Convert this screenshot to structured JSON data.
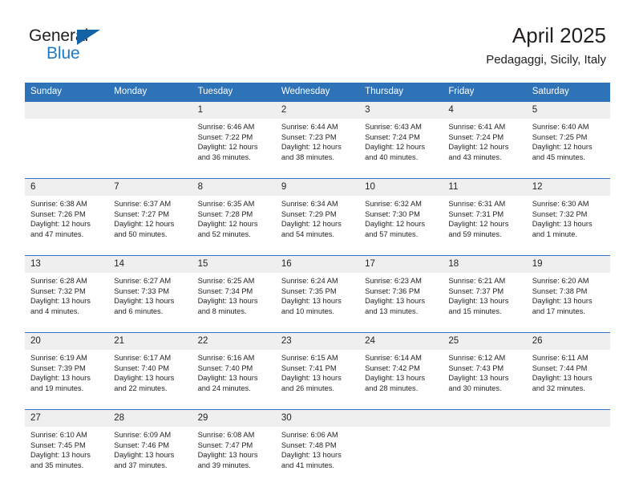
{
  "brand": {
    "name_top": "General",
    "name_bottom": "Blue",
    "triangle_color": "#1464a5",
    "blue_color": "#1f7ac4"
  },
  "header": {
    "title": "April 2025",
    "subtitle": "Pedagaggi, Sicily, Italy"
  },
  "theme": {
    "header_blue": "#2e72b8",
    "daynum_gray": "#efefef",
    "text": "#231f20"
  },
  "calendar": {
    "weekday_headers": [
      "Sunday",
      "Monday",
      "Tuesday",
      "Wednesday",
      "Thursday",
      "Friday",
      "Saturday"
    ],
    "weeks": [
      [
        {
          "day": "",
          "lines": []
        },
        {
          "day": "",
          "lines": []
        },
        {
          "day": "1",
          "lines": [
            "Sunrise: 6:46 AM",
            "Sunset: 7:22 PM",
            "Daylight: 12 hours",
            "and 36 minutes."
          ]
        },
        {
          "day": "2",
          "lines": [
            "Sunrise: 6:44 AM",
            "Sunset: 7:23 PM",
            "Daylight: 12 hours",
            "and 38 minutes."
          ]
        },
        {
          "day": "3",
          "lines": [
            "Sunrise: 6:43 AM",
            "Sunset: 7:24 PM",
            "Daylight: 12 hours",
            "and 40 minutes."
          ]
        },
        {
          "day": "4",
          "lines": [
            "Sunrise: 6:41 AM",
            "Sunset: 7:24 PM",
            "Daylight: 12 hours",
            "and 43 minutes."
          ]
        },
        {
          "day": "5",
          "lines": [
            "Sunrise: 6:40 AM",
            "Sunset: 7:25 PM",
            "Daylight: 12 hours",
            "and 45 minutes."
          ]
        }
      ],
      [
        {
          "day": "6",
          "lines": [
            "Sunrise: 6:38 AM",
            "Sunset: 7:26 PM",
            "Daylight: 12 hours",
            "and 47 minutes."
          ]
        },
        {
          "day": "7",
          "lines": [
            "Sunrise: 6:37 AM",
            "Sunset: 7:27 PM",
            "Daylight: 12 hours",
            "and 50 minutes."
          ]
        },
        {
          "day": "8",
          "lines": [
            "Sunrise: 6:35 AM",
            "Sunset: 7:28 PM",
            "Daylight: 12 hours",
            "and 52 minutes."
          ]
        },
        {
          "day": "9",
          "lines": [
            "Sunrise: 6:34 AM",
            "Sunset: 7:29 PM",
            "Daylight: 12 hours",
            "and 54 minutes."
          ]
        },
        {
          "day": "10",
          "lines": [
            "Sunrise: 6:32 AM",
            "Sunset: 7:30 PM",
            "Daylight: 12 hours",
            "and 57 minutes."
          ]
        },
        {
          "day": "11",
          "lines": [
            "Sunrise: 6:31 AM",
            "Sunset: 7:31 PM",
            "Daylight: 12 hours",
            "and 59 minutes."
          ]
        },
        {
          "day": "12",
          "lines": [
            "Sunrise: 6:30 AM",
            "Sunset: 7:32 PM",
            "Daylight: 13 hours",
            "and 1 minute."
          ]
        }
      ],
      [
        {
          "day": "13",
          "lines": [
            "Sunrise: 6:28 AM",
            "Sunset: 7:32 PM",
            "Daylight: 13 hours",
            "and 4 minutes."
          ]
        },
        {
          "day": "14",
          "lines": [
            "Sunrise: 6:27 AM",
            "Sunset: 7:33 PM",
            "Daylight: 13 hours",
            "and 6 minutes."
          ]
        },
        {
          "day": "15",
          "lines": [
            "Sunrise: 6:25 AM",
            "Sunset: 7:34 PM",
            "Daylight: 13 hours",
            "and 8 minutes."
          ]
        },
        {
          "day": "16",
          "lines": [
            "Sunrise: 6:24 AM",
            "Sunset: 7:35 PM",
            "Daylight: 13 hours",
            "and 10 minutes."
          ]
        },
        {
          "day": "17",
          "lines": [
            "Sunrise: 6:23 AM",
            "Sunset: 7:36 PM",
            "Daylight: 13 hours",
            "and 13 minutes."
          ]
        },
        {
          "day": "18",
          "lines": [
            "Sunrise: 6:21 AM",
            "Sunset: 7:37 PM",
            "Daylight: 13 hours",
            "and 15 minutes."
          ]
        },
        {
          "day": "19",
          "lines": [
            "Sunrise: 6:20 AM",
            "Sunset: 7:38 PM",
            "Daylight: 13 hours",
            "and 17 minutes."
          ]
        }
      ],
      [
        {
          "day": "20",
          "lines": [
            "Sunrise: 6:19 AM",
            "Sunset: 7:39 PM",
            "Daylight: 13 hours",
            "and 19 minutes."
          ]
        },
        {
          "day": "21",
          "lines": [
            "Sunrise: 6:17 AM",
            "Sunset: 7:40 PM",
            "Daylight: 13 hours",
            "and 22 minutes."
          ]
        },
        {
          "day": "22",
          "lines": [
            "Sunrise: 6:16 AM",
            "Sunset: 7:40 PM",
            "Daylight: 13 hours",
            "and 24 minutes."
          ]
        },
        {
          "day": "23",
          "lines": [
            "Sunrise: 6:15 AM",
            "Sunset: 7:41 PM",
            "Daylight: 13 hours",
            "and 26 minutes."
          ]
        },
        {
          "day": "24",
          "lines": [
            "Sunrise: 6:14 AM",
            "Sunset: 7:42 PM",
            "Daylight: 13 hours",
            "and 28 minutes."
          ]
        },
        {
          "day": "25",
          "lines": [
            "Sunrise: 6:12 AM",
            "Sunset: 7:43 PM",
            "Daylight: 13 hours",
            "and 30 minutes."
          ]
        },
        {
          "day": "26",
          "lines": [
            "Sunrise: 6:11 AM",
            "Sunset: 7:44 PM",
            "Daylight: 13 hours",
            "and 32 minutes."
          ]
        }
      ],
      [
        {
          "day": "27",
          "lines": [
            "Sunrise: 6:10 AM",
            "Sunset: 7:45 PM",
            "Daylight: 13 hours",
            "and 35 minutes."
          ]
        },
        {
          "day": "28",
          "lines": [
            "Sunrise: 6:09 AM",
            "Sunset: 7:46 PM",
            "Daylight: 13 hours",
            "and 37 minutes."
          ]
        },
        {
          "day": "29",
          "lines": [
            "Sunrise: 6:08 AM",
            "Sunset: 7:47 PM",
            "Daylight: 13 hours",
            "and 39 minutes."
          ]
        },
        {
          "day": "30",
          "lines": [
            "Sunrise: 6:06 AM",
            "Sunset: 7:48 PM",
            "Daylight: 13 hours",
            "and 41 minutes."
          ]
        },
        {
          "day": "",
          "lines": []
        },
        {
          "day": "",
          "lines": []
        },
        {
          "day": "",
          "lines": []
        }
      ]
    ]
  }
}
